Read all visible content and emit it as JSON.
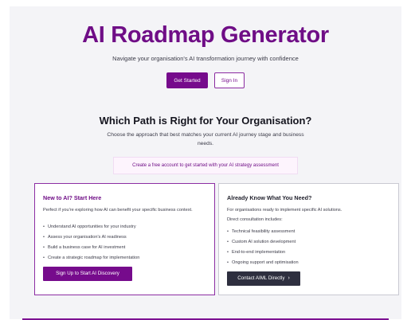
{
  "hero": {
    "title": "AI Roadmap Generator",
    "subtitle": "Navigate your organisation's AI transformation journey with confidence",
    "get_started_label": "Get Started",
    "sign_in_label": "Sign In"
  },
  "paths": {
    "title": "Which Path is Right for Your Organisation?",
    "subtitle": "Choose the approach that best matches your current AI journey stage and business needs.",
    "notice": "Create a free account to get started with your AI strategy assessment"
  },
  "cards": {
    "new": {
      "title": "New to AI? Start Here",
      "description": "Perfect if you're exploring how AI can benefit your specific business context.",
      "items": [
        "Understand AI opportunities for your industry",
        "Assess your organisation's AI readiness",
        "Build a business case for AI investment",
        "Create a strategic roadmap for implementation"
      ],
      "button_label": "Sign Up to Start AI Discovery"
    },
    "ready": {
      "title": "Already Know What You Need?",
      "description": "For organisations ready to implement specific AI solutions.",
      "list_heading": "Direct consultation includes:",
      "items": [
        "Technical feasibility assessment",
        "Custom AI solution development",
        "End-to-end implementation",
        "Ongoing support and optimisation"
      ],
      "button_label": "Contact AIML Directly",
      "button_icon": "chevron-right-icon"
    }
  },
  "colors": {
    "brand": "#760b8c",
    "dark_button": "#2e2f3f",
    "background": "#f4f4f7"
  }
}
